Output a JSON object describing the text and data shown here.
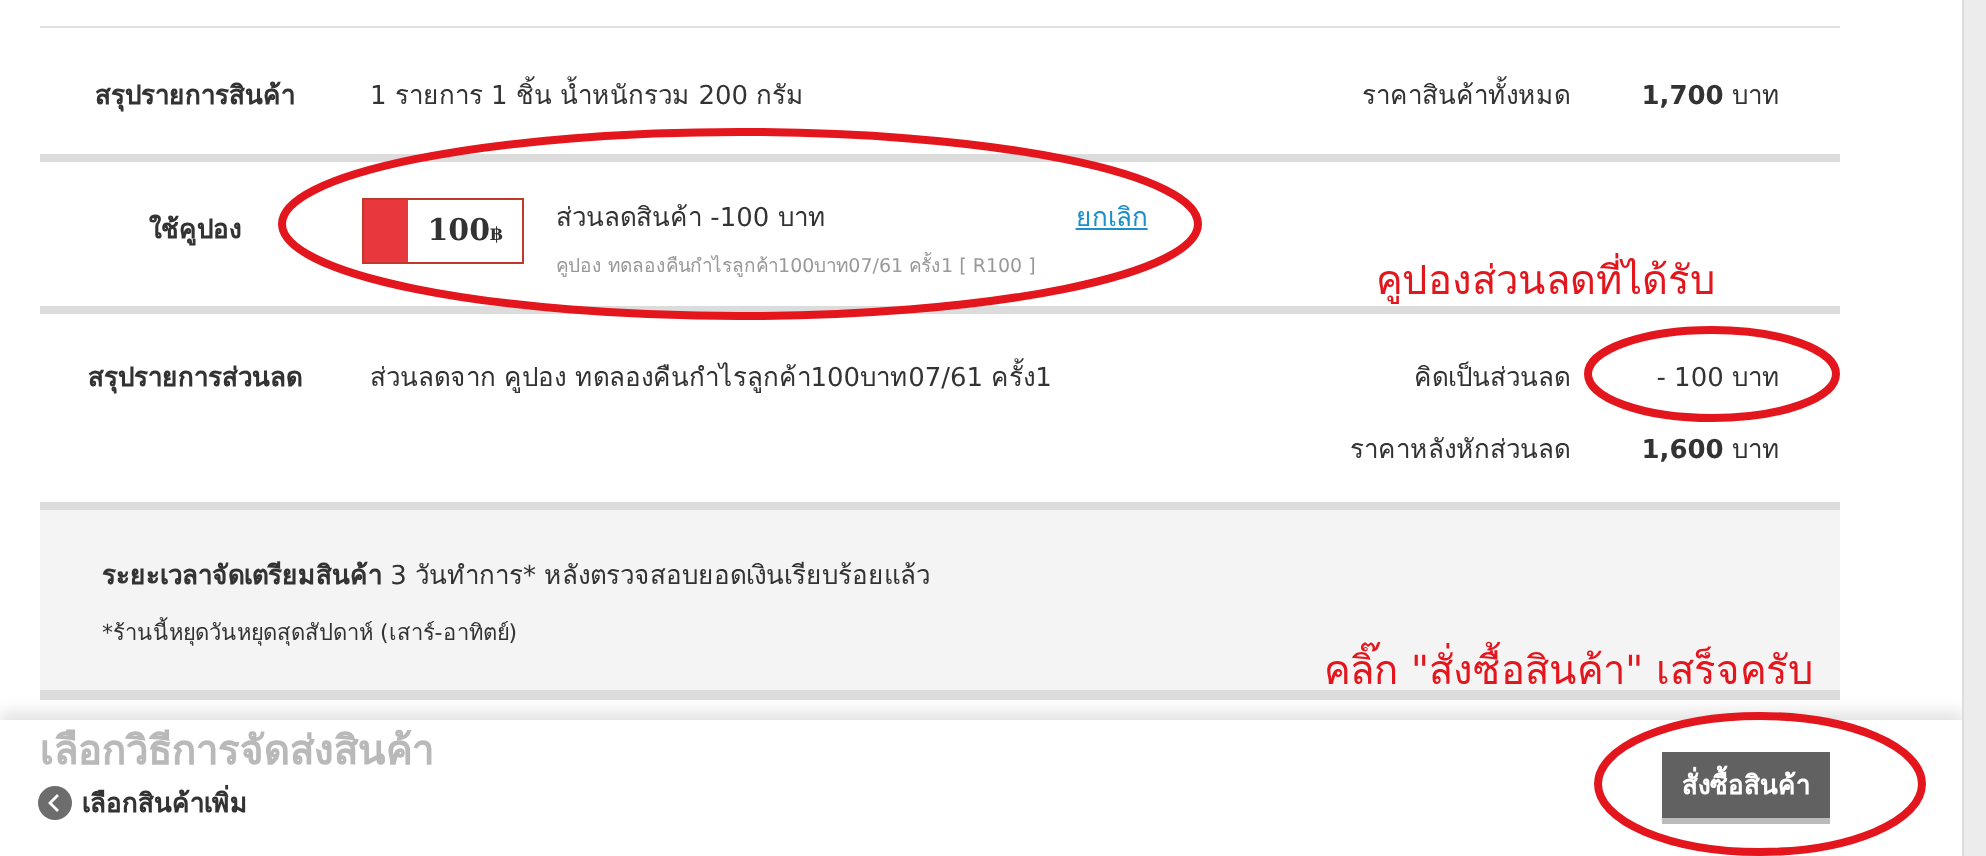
{
  "product_summary": {
    "label": "สรุปรายการสินค้า",
    "detail": "1 รายการ 1 ชิ้น น้ำหนักรวม 200 กรัม",
    "total_label": "ราคาสินค้าทั้งหมด",
    "total_amount": "**1,700** บาท"
  },
  "coupon": {
    "label": "ใช้คูปอง",
    "value": "100",
    "currency": "฿",
    "title": "ส่วนลดสินค้า -100 บาท",
    "detail": "คูปอง ทดลองคืนกำไรลูกค้า100บาท07/61 ครั้ง1 [ R100 ]",
    "cancel": "ยกเลิก"
  },
  "discount_summary": {
    "label": "สรุปรายการส่วนลด",
    "detail": "ส่วนลดจาก คูปอง ทดลองคืนกำไรลูกค้า100บาท07/61 ครั้ง1",
    "lines": [
      {
        "label": "คิดเป็นส่วนลด",
        "amount": "- 100 บาท"
      },
      {
        "label": "ราคาหลังหักส่วนลด",
        "amount": "**1,600** บาท"
      }
    ]
  },
  "notice": {
    "text": "**ระยะเวลาจัดเตรียมสินค้า** 3 วันทำการ* หลังตรวจสอบยอดเงินเรียบร้อยแล้ว",
    "note": "*ร้านนี้หยุดวันหยุดสุดสัปดาห์ (เสาร์-อาทิตย์)"
  },
  "next_section_heading": "เลือกวิธีการจัดส่งสินค้า",
  "footer": {
    "back_link": "เลือกสินค้าเพิ่ม",
    "order_button": "สั่งซื้อสินค้า"
  },
  "annotations": [
    {
      "text": "คูปองส่วนลดที่ได้รับ"
    },
    {
      "text": "คลิ๊ก \"สั่งซื้อสินค้า\" เสร็จครับ"
    }
  ]
}
